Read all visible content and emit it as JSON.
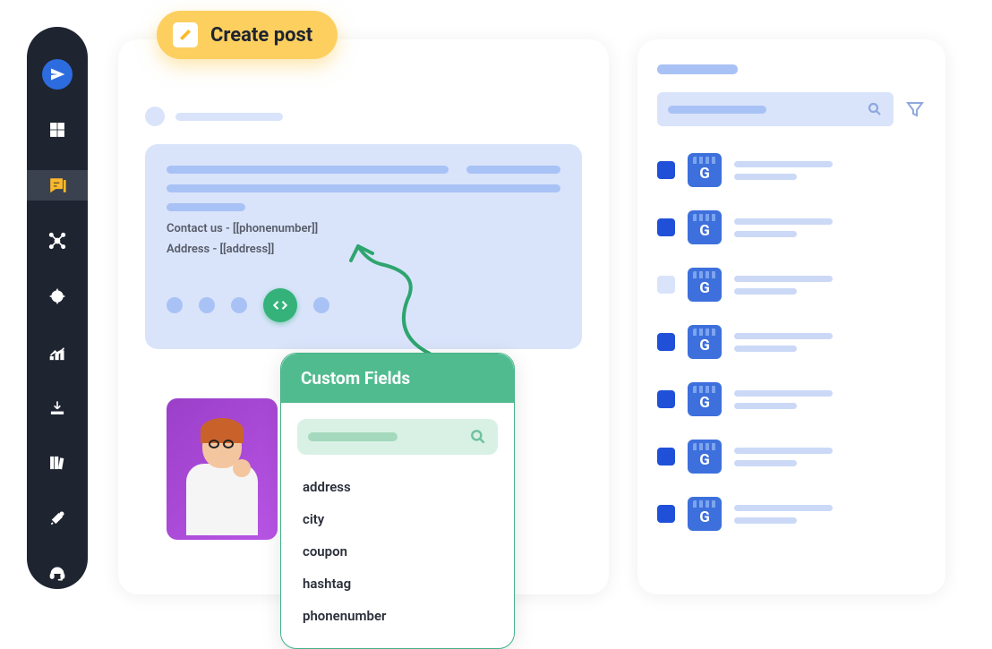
{
  "sidebar": {
    "items": [
      {
        "name": "send",
        "active": false
      },
      {
        "name": "dashboard",
        "active": false
      },
      {
        "name": "posts",
        "active": true
      },
      {
        "name": "network",
        "active": false
      },
      {
        "name": "target",
        "active": false
      },
      {
        "name": "analytics",
        "active": false
      },
      {
        "name": "download",
        "active": false
      },
      {
        "name": "library",
        "active": false
      },
      {
        "name": "tools",
        "active": false
      },
      {
        "name": "support",
        "active": false
      }
    ]
  },
  "create_post": {
    "label": "Create post"
  },
  "composer": {
    "contact_line": "Contact us - [[phonenumber]]",
    "address_line": "Address - [[address]]"
  },
  "custom_fields": {
    "title": "Custom Fields",
    "items": [
      "address",
      "city",
      "coupon",
      "hashtag",
      "phonenumber"
    ]
  },
  "right_panel": {
    "items": [
      {
        "checked": true
      },
      {
        "checked": true
      },
      {
        "checked": false
      },
      {
        "checked": true
      },
      {
        "checked": true
      },
      {
        "checked": true
      },
      {
        "checked": true
      }
    ]
  }
}
